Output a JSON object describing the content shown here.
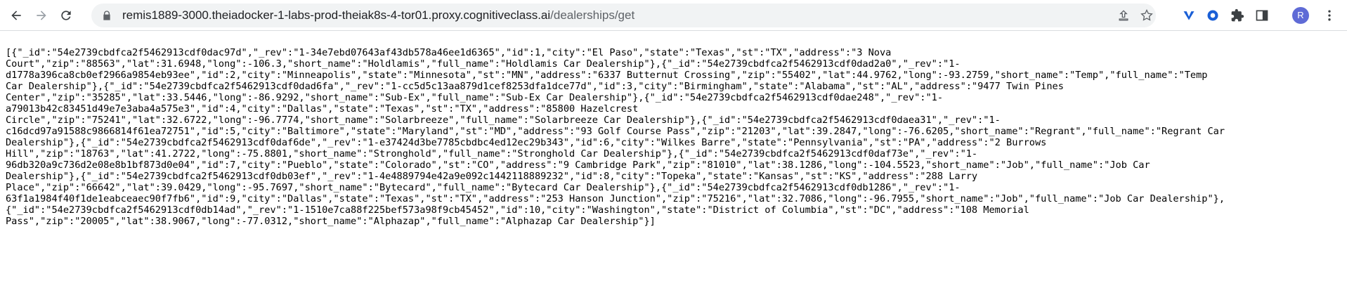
{
  "browser": {
    "url_host": "remis1889-3000.theiadocker-1-labs-prod-theiak8s-4-tor01.proxy.cognitiveclass.ai",
    "url_path": "/dealerships/get",
    "avatar_letter": "R",
    "icons": [
      "back-icon",
      "forward-icon",
      "reload-icon",
      "lock-icon",
      "share-icon",
      "star-icon",
      "extension-v-icon",
      "extension-circle-icon",
      "puzzle-icon",
      "sidebar-icon",
      "kebab-menu-icon"
    ]
  },
  "page": {
    "lines": [
      "[{\"_id\":\"54e2739cbdfca2f5462913cdf0dac97d\",\"_rev\":\"1-34e7ebd07643af43db578a46ee1d6365\",\"id\":1,\"city\":\"El Paso\",\"state\":\"Texas\",\"st\":\"TX\",\"address\":\"3 Nova",
      "Court\",\"zip\":\"88563\",\"lat\":31.6948,\"long\":-106.3,\"short_name\":\"Holdlamis\",\"full_name\":\"Holdlamis Car Dealership\"},{\"_id\":\"54e2739cbdfca2f5462913cdf0dad2a0\",\"_rev\":\"1-",
      "d1778a396ca8cb0ef2966a9854eb93ee\",\"id\":2,\"city\":\"Minneapolis\",\"state\":\"Minnesota\",\"st\":\"MN\",\"address\":\"6337 Butternut Crossing\",\"zip\":\"55402\",\"lat\":44.9762,\"long\":-93.2759,\"short_name\":\"Temp\",\"full_name\":\"Temp",
      "Car Dealership\"},{\"_id\":\"54e2739cbdfca2f5462913cdf0dad6fa\",\"_rev\":\"1-cc5d5c13aa879d1cef8253dfa1dce77d\",\"id\":3,\"city\":\"Birmingham\",\"state\":\"Alabama\",\"st\":\"AL\",\"address\":\"9477 Twin Pines",
      "Center\",\"zip\":\"35285\",\"lat\":33.5446,\"long\":-86.9292,\"short_name\":\"Sub-Ex\",\"full_name\":\"Sub-Ex Car Dealership\"},{\"_id\":\"54e2739cbdfca2f5462913cdf0dae248\",\"_rev\":\"1-",
      "a79013b42c83451d49e7e3aba4a575e3\",\"id\":4,\"city\":\"Dallas\",\"state\":\"Texas\",\"st\":\"TX\",\"address\":\"85800 Hazelcrest",
      "Circle\",\"zip\":\"75241\",\"lat\":32.6722,\"long\":-96.7774,\"short_name\":\"Solarbreeze\",\"full_name\":\"Solarbreeze Car Dealership\"},{\"_id\":\"54e2739cbdfca2f5462913cdf0daea31\",\"_rev\":\"1-",
      "c16dcd97a91588c9866814f61ea72751\",\"id\":5,\"city\":\"Baltimore\",\"state\":\"Maryland\",\"st\":\"MD\",\"address\":\"93 Golf Course Pass\",\"zip\":\"21203\",\"lat\":39.2847,\"long\":-76.6205,\"short_name\":\"Regrant\",\"full_name\":\"Regrant Car",
      "Dealership\"},{\"_id\":\"54e2739cbdfca2f5462913cdf0daf6de\",\"_rev\":\"1-e37424d3be7785cbdbc4ed12ec29b343\",\"id\":6,\"city\":\"Wilkes Barre\",\"state\":\"Pennsylvania\",\"st\":\"PA\",\"address\":\"2 Burrows",
      "Hill\",\"zip\":\"18763\",\"lat\":41.2722,\"long\":-75.8801,\"short_name\":\"Stronghold\",\"full_name\":\"Stronghold Car Dealership\"},{\"_id\":\"54e2739cbdfca2f5462913cdf0daf73e\",\"_rev\":\"1-",
      "96db320a9c736d2e08e8b1bf873d0e04\",\"id\":7,\"city\":\"Pueblo\",\"state\":\"Colorado\",\"st\":\"CO\",\"address\":\"9 Cambridge Park\",\"zip\":\"81010\",\"lat\":38.1286,\"long\":-104.5523,\"short_name\":\"Job\",\"full_name\":\"Job Car",
      "Dealership\"},{\"_id\":\"54e2739cbdfca2f5462913cdf0db03ef\",\"_rev\":\"1-4e4889794e42a9e092c1442118889232\",\"id\":8,\"city\":\"Topeka\",\"state\":\"Kansas\",\"st\":\"KS\",\"address\":\"288 Larry",
      "Place\",\"zip\":\"66642\",\"lat\":39.0429,\"long\":-95.7697,\"short_name\":\"Bytecard\",\"full_name\":\"Bytecard Car Dealership\"},{\"_id\":\"54e2739cbdfca2f5462913cdf0db1286\",\"_rev\":\"1-",
      "63f1a1984f40f1de1eabceaec90f7fb6\",\"id\":9,\"city\":\"Dallas\",\"state\":\"Texas\",\"st\":\"TX\",\"address\":\"253 Hanson Junction\",\"zip\":\"75216\",\"lat\":32.7086,\"long\":-96.7955,\"short_name\":\"Job\",\"full_name\":\"Job Car Dealership\"},",
      "{\"_id\":\"54e2739cbdfca2f5462913cdf0db14ad\",\"_rev\":\"1-1510e7ca88f225bef573a98f9cb45452\",\"id\":10,\"city\":\"Washington\",\"state\":\"District of Columbia\",\"st\":\"DC\",\"address\":\"108 Memorial",
      "Pass\",\"zip\":\"20005\",\"lat\":38.9067,\"long\":-77.0312,\"short_name\":\"Alphazap\",\"full_name\":\"Alphazap Car Dealership\"}]"
    ]
  }
}
